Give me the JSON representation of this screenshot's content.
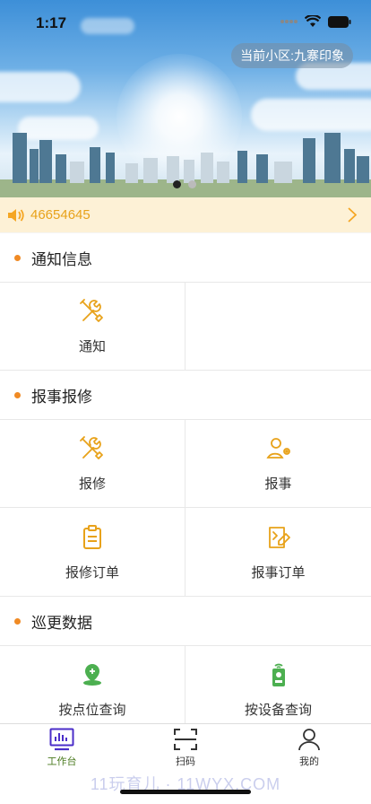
{
  "status_bar": {
    "time": "1:17"
  },
  "hero": {
    "community_label": "当前小区:九寨印象",
    "page_count": 2,
    "active_page": 1
  },
  "notice": {
    "text": "46654645"
  },
  "sections": [
    {
      "title": "通知信息",
      "items": [
        {
          "label": "通知",
          "icon": "wrench-screwdriver-icon"
        }
      ]
    },
    {
      "title": "报事报修",
      "items": [
        {
          "label": "报修",
          "icon": "wrench-screwdriver-icon"
        },
        {
          "label": "报事",
          "icon": "person-gear-icon"
        },
        {
          "label": "报修订单",
          "icon": "clipboard-icon"
        },
        {
          "label": "报事订单",
          "icon": "notepad-icon"
        }
      ]
    },
    {
      "title": "巡更数据",
      "items": [
        {
          "label": "按点位查询",
          "icon": "location-pin-icon"
        },
        {
          "label": "按设备查询",
          "icon": "device-icon"
        }
      ]
    }
  ],
  "tabbar": {
    "items": [
      {
        "label": "工作台",
        "icon": "monitor-icon",
        "active": true
      },
      {
        "label": "扫码",
        "icon": "scan-icon",
        "active": false
      },
      {
        "label": "我的",
        "icon": "user-icon",
        "active": false
      }
    ]
  },
  "watermark": "11玩育儿 · 11WYX.COM",
  "colors": {
    "accent": "#f5a623",
    "bullet": "#f08a24",
    "green": "#4caf50",
    "tab_active": "#4a7a1e",
    "tab_icon_active": "#4b2ec9"
  }
}
